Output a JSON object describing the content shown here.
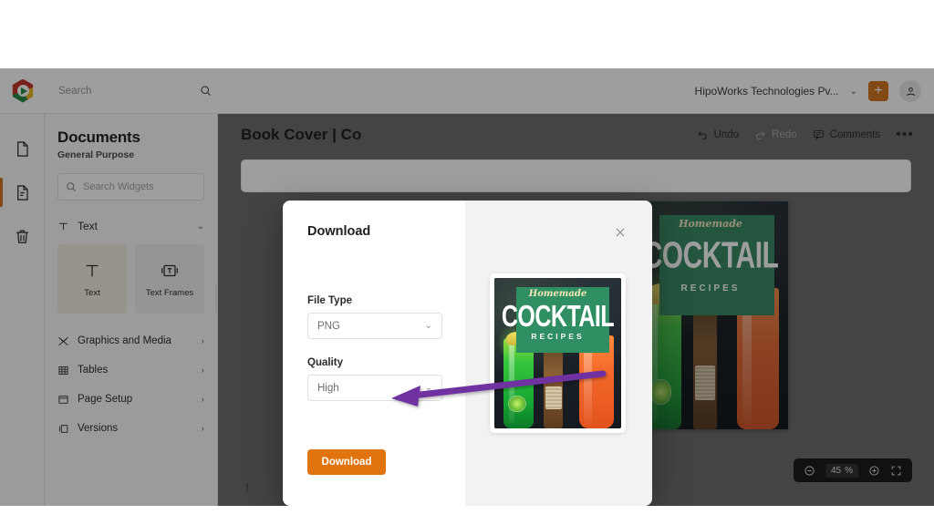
{
  "topbar": {
    "search_placeholder": "Search",
    "search_icon": "search-icon",
    "logo_icon": "app-logo-icon",
    "org_name": "HipoWorks Technologies Pv...",
    "org_chevron": "⌄",
    "add_label": "+",
    "avatar_icon": "user-avatar-icon"
  },
  "rail": {
    "items": [
      {
        "icon": "blank-page-icon",
        "active": false
      },
      {
        "icon": "document-lines-icon",
        "active": true
      },
      {
        "icon": "trash-icon",
        "active": false
      }
    ]
  },
  "sidebar": {
    "title": "Documents",
    "subtitle": "General Purpose",
    "search_placeholder": "Search Widgets",
    "search_icon": "search-icon",
    "text_category": {
      "label": "Text",
      "icon": "text-T-icon",
      "chevron": "⌄"
    },
    "widgets": [
      {
        "label": "Text",
        "icon": "text-glyph-icon"
      },
      {
        "label": "Text Frames",
        "icon": "text-frame-icon"
      }
    ],
    "categories": [
      {
        "label": "Graphics and Media",
        "icon": "graphics-media-icon",
        "chevron": "›"
      },
      {
        "label": "Tables",
        "icon": "table-grid-icon",
        "chevron": "›"
      },
      {
        "label": "Page Setup",
        "icon": "page-setup-icon",
        "chevron": "›"
      },
      {
        "label": "Versions",
        "icon": "versions-icon",
        "chevron": "›"
      }
    ]
  },
  "document": {
    "title": "Book Cover | Co",
    "actions": [
      {
        "label": "Undo",
        "icon": "undo-arrow-icon",
        "disabled": false
      },
      {
        "label": "Redo",
        "icon": "redo-arrow-icon",
        "disabled": true
      },
      {
        "label": "Comments",
        "icon": "comment-bubble-icon",
        "disabled": false
      }
    ],
    "more_label": "•••"
  },
  "zoom_control": {
    "minus_icon": "zoom-out-icon",
    "value": "45",
    "unit": "%",
    "plus_icon": "zoom-in-icon",
    "fullscreen_icon": "fit-screen-icon"
  },
  "modal": {
    "title": "Download",
    "close_icon": "close-icon",
    "fields": [
      {
        "label": "File Type",
        "value": "PNG",
        "chevron": "⌄"
      },
      {
        "label": "Quality",
        "value": "High",
        "chevron": "⌄"
      }
    ],
    "submit_label": "Download",
    "accent_color": "#e1740f"
  },
  "cover_art": {
    "eyebrow": "Homemade",
    "headline": "COCKTAIL",
    "subhead": "RECIPES",
    "panel_color": "#2f8f62"
  },
  "annotation": {
    "arrow_color": "#7030a0",
    "name": "arrow-pointing-to-download-button"
  }
}
